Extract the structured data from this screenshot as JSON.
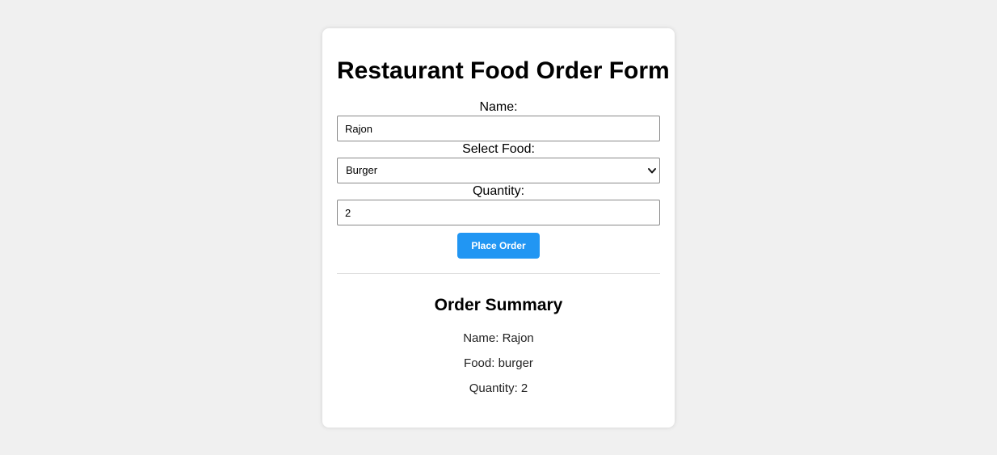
{
  "form": {
    "title": "Restaurant Food Order Form",
    "name_label": "Name:",
    "name_value": "Rajon",
    "food_label": "Select Food:",
    "food_selected": "Burger",
    "quantity_label": "Quantity:",
    "quantity_value": "2",
    "submit_label": "Place Order"
  },
  "summary": {
    "title": "Order Summary",
    "name_line": "Name: Rajon",
    "food_line": "Food: burger",
    "quantity_line": "Quantity: 2"
  },
  "colors": {
    "page_background": "#f0f0f0",
    "card_background": "#ffffff",
    "button_background": "#2196f3",
    "button_text": "#ffffff"
  },
  "icons": {
    "select_arrow": "chevron-down-icon"
  }
}
